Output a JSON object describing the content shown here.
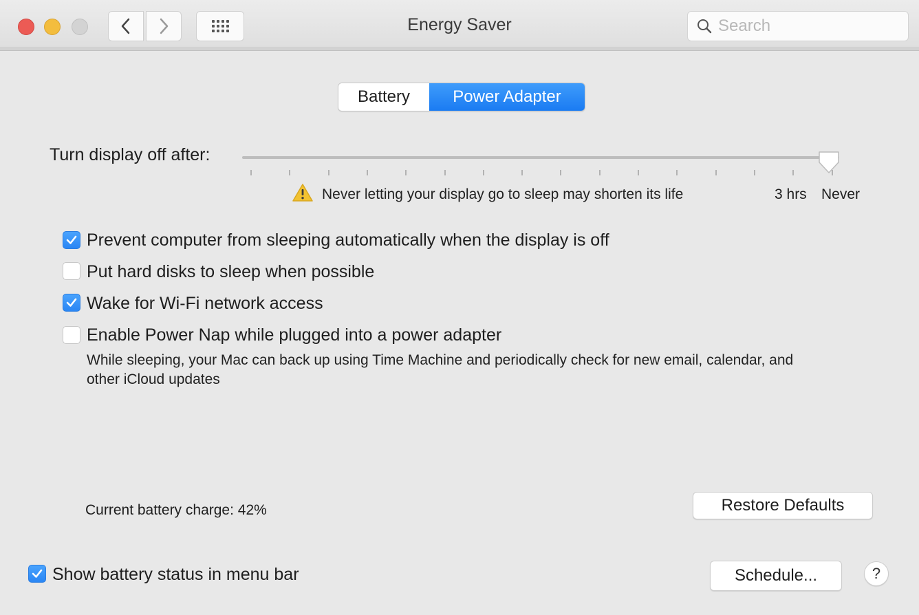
{
  "window": {
    "title": "Energy Saver",
    "search_placeholder": "Search"
  },
  "icons": {
    "back": "chevron-left-icon",
    "forward": "chevron-right-icon",
    "grid": "grid-icon",
    "search": "search-icon",
    "warning": "warning-icon",
    "check": "checkmark-icon"
  },
  "tabs": [
    {
      "label": "Battery",
      "selected": false
    },
    {
      "label": "Power Adapter",
      "selected": true
    }
  ],
  "display_sleep": {
    "label": "Turn display off after:",
    "value": "Never",
    "warning": "Never letting your display go to sleep may shorten its life",
    "tick_labels": [
      "3 hrs",
      "Never"
    ]
  },
  "options": [
    {
      "label": "Prevent computer from sleeping automatically when the display is off",
      "checked": true
    },
    {
      "label": "Put hard disks to sleep when possible",
      "checked": false
    },
    {
      "label": "Wake for Wi-Fi network access",
      "checked": true
    },
    {
      "label": "Enable Power Nap while plugged into a power adapter",
      "checked": false
    }
  ],
  "power_nap_description": "While sleeping, your Mac can back up using Time Machine and periodically check for new email, calendar, and other iCloud updates",
  "battery_charge": "Current battery charge: 42%",
  "buttons": {
    "restore": "Restore Defaults",
    "schedule": "Schedule...",
    "help": "?"
  },
  "show_battery_status": {
    "label": "Show battery status in menu bar",
    "checked": true
  },
  "colors": {
    "accent": "#2a86f4",
    "close": "#ec5b55",
    "minimize": "#f3bd3e",
    "warning": "#f2c230"
  }
}
